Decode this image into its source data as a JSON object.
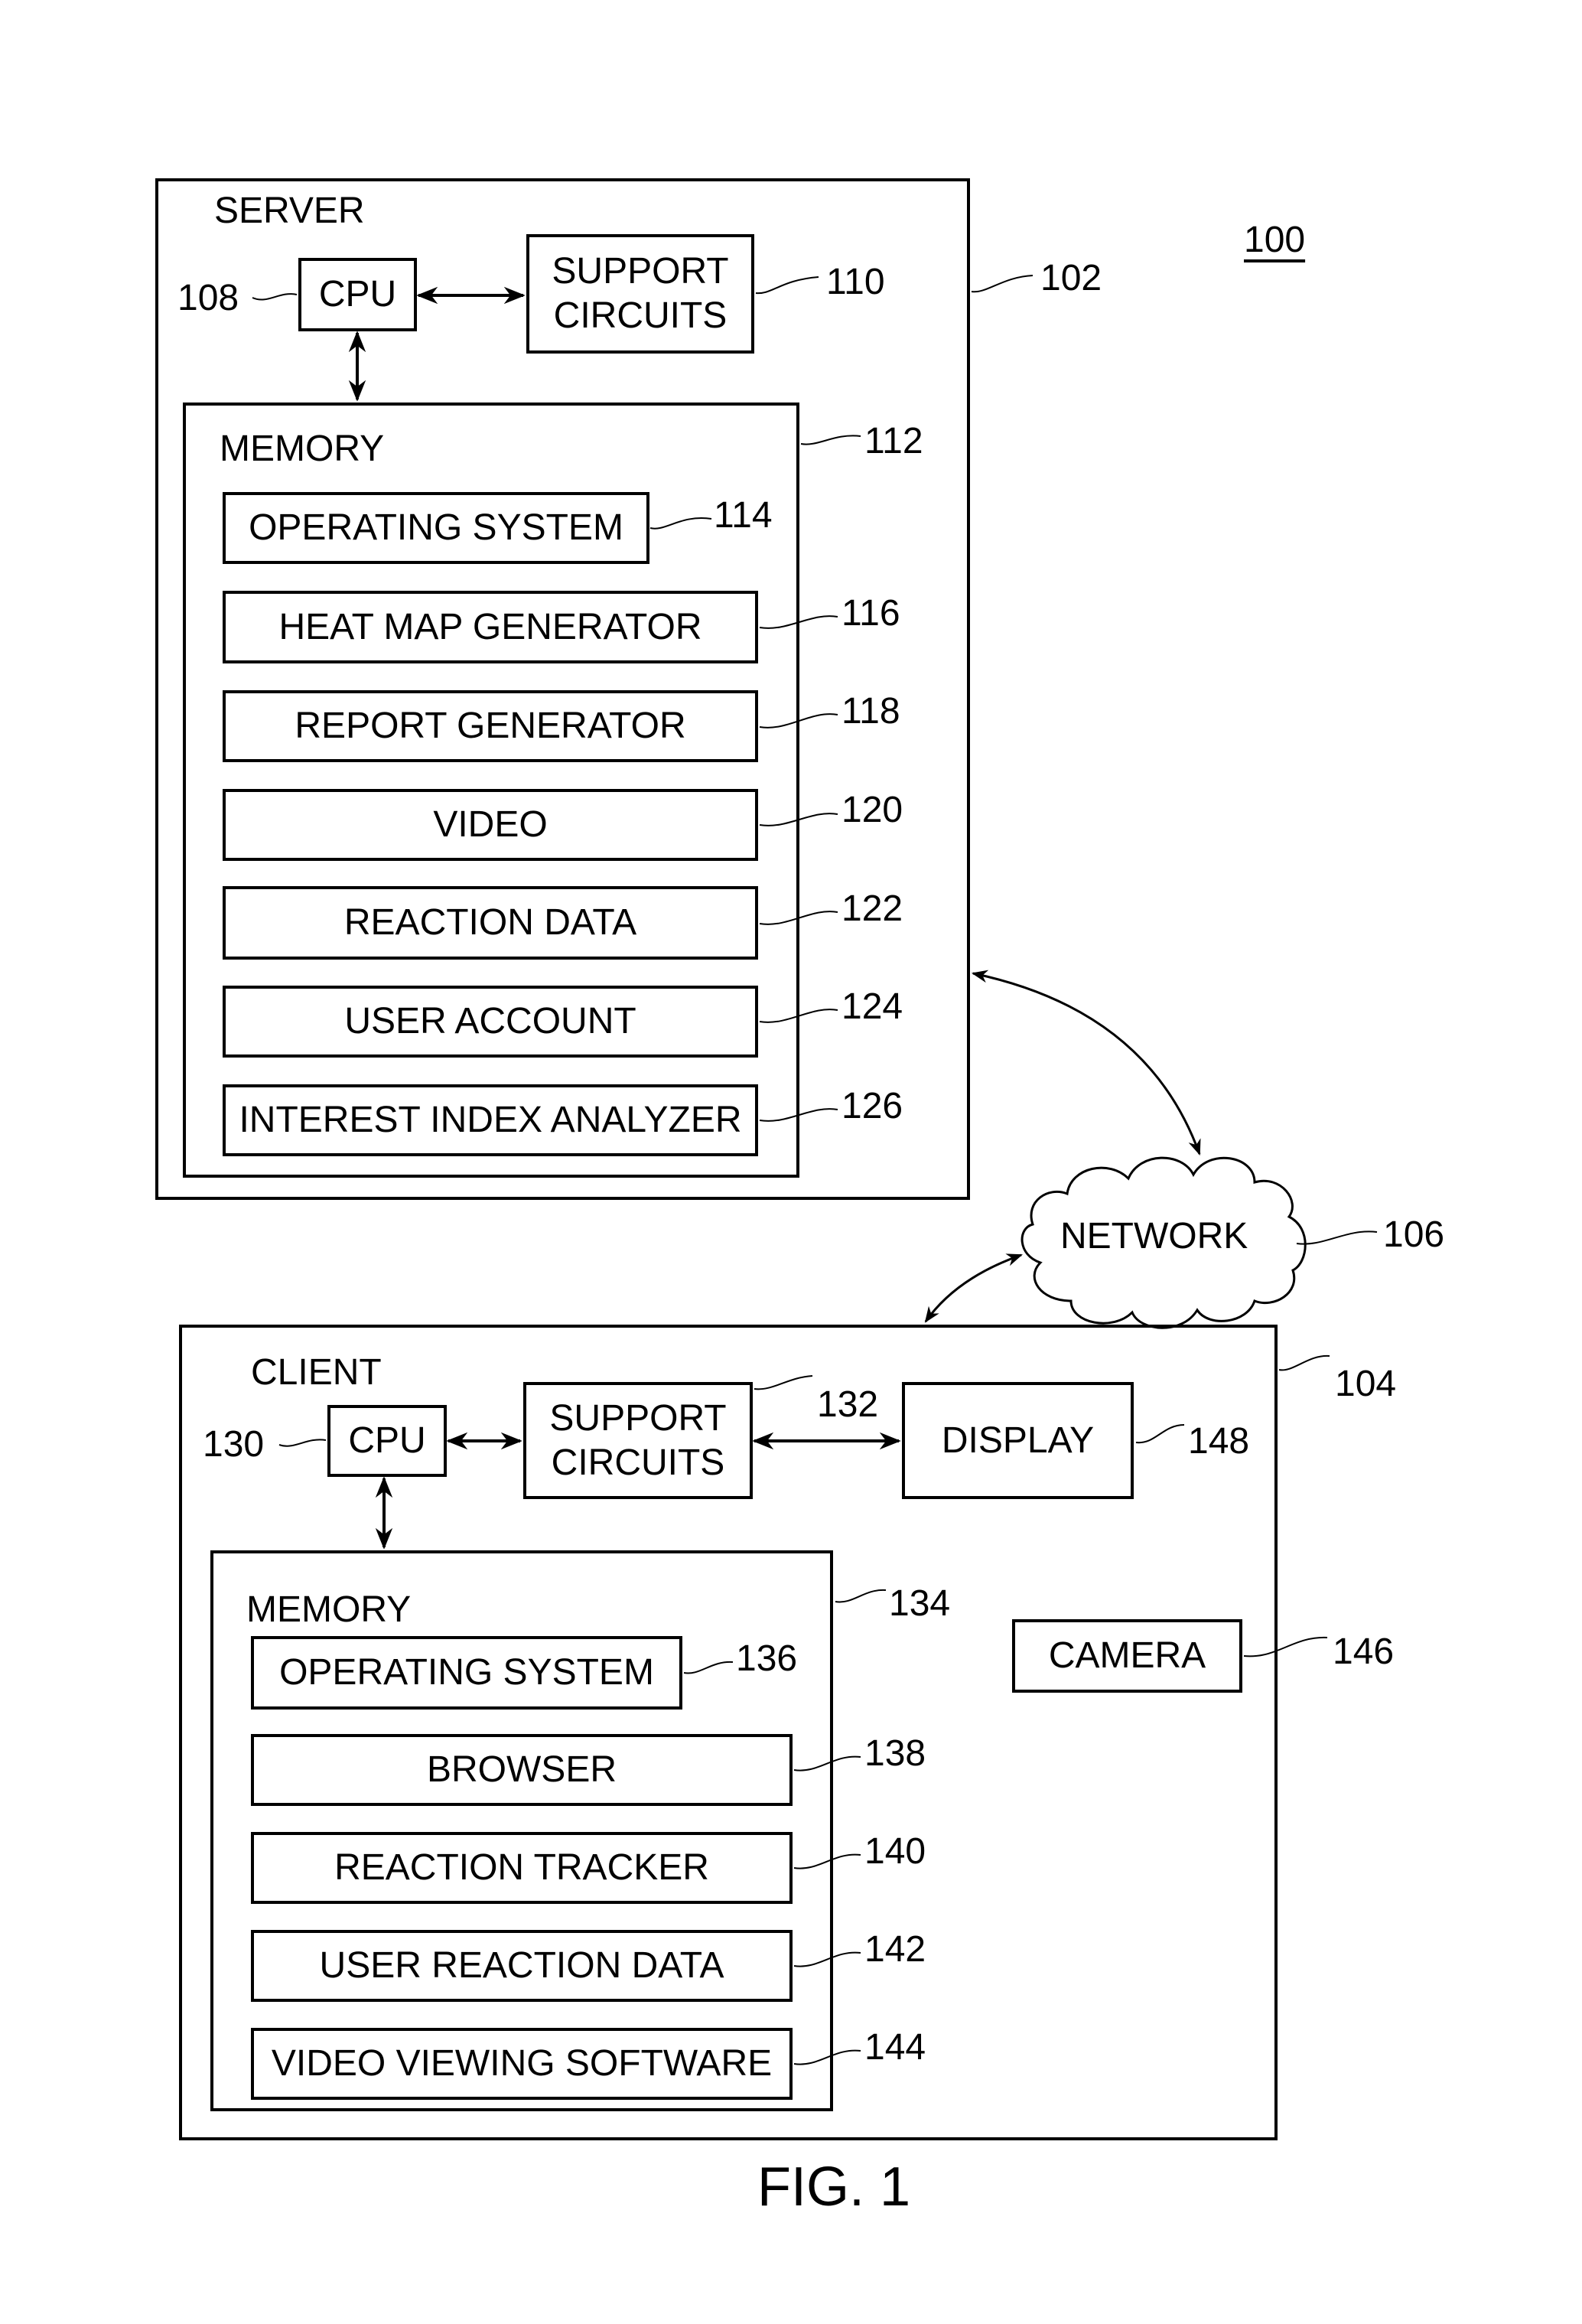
{
  "figure": {
    "system_ref": "100",
    "caption": "FIG. 1"
  },
  "server": {
    "title": "SERVER",
    "ref": "102",
    "cpu": {
      "label": "CPU",
      "ref": "108"
    },
    "support_circuits": {
      "label": "SUPPORT CIRCUITS",
      "line1": "SUPPORT",
      "line2": "CIRCUITS",
      "ref": "110"
    },
    "memory": {
      "title": "MEMORY",
      "ref": "112",
      "items": [
        {
          "label": "OPERATING SYSTEM",
          "ref": "114"
        },
        {
          "label": "HEAT MAP GENERATOR",
          "ref": "116"
        },
        {
          "label": "REPORT GENERATOR",
          "ref": "118"
        },
        {
          "label": "VIDEO",
          "ref": "120"
        },
        {
          "label": "REACTION DATA",
          "ref": "122"
        },
        {
          "label": "USER ACCOUNT",
          "ref": "124"
        },
        {
          "label": "INTEREST INDEX ANALYZER",
          "ref": "126"
        }
      ]
    }
  },
  "network": {
    "label": "NETWORK",
    "ref": "106"
  },
  "client": {
    "title": "CLIENT",
    "ref": "104",
    "cpu": {
      "label": "CPU",
      "ref": "130"
    },
    "support_circuits": {
      "line1": "SUPPORT",
      "line2": "CIRCUITS",
      "ref": "132"
    },
    "display": {
      "label": "DISPLAY",
      "ref": "148"
    },
    "camera": {
      "label": "CAMERA",
      "ref": "146"
    },
    "memory": {
      "title": "MEMORY",
      "ref": "134",
      "items": [
        {
          "label": "OPERATING SYSTEM",
          "ref": "136"
        },
        {
          "label": "BROWSER",
          "ref": "138"
        },
        {
          "label": "REACTION TRACKER",
          "ref": "140"
        },
        {
          "label": "USER REACTION DATA",
          "ref": "142"
        },
        {
          "label": "VIDEO VIEWING SOFTWARE",
          "ref": "144"
        }
      ]
    }
  }
}
